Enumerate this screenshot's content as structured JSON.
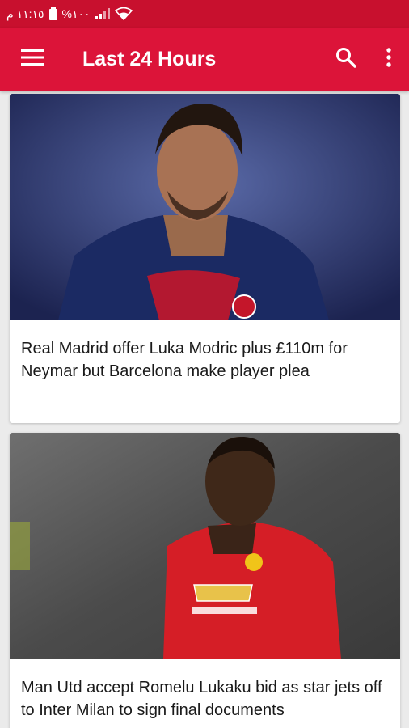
{
  "status_bar": {
    "time": "١١:١٥ م",
    "battery": "%١٠٠"
  },
  "app_bar": {
    "title": "Last 24 Hours",
    "menu_icon": "hamburger-menu-icon",
    "search_icon": "search-icon",
    "overflow_icon": "more-vert-icon"
  },
  "articles": [
    {
      "headline": "Real Madrid offer Luka Modric plus £110m for Neymar but Barcelona make player plea",
      "image": "neymar-psg-photo"
    },
    {
      "headline": "Man Utd accept Romelu Lukaku bid as star jets off to Inter Milan to sign final documents",
      "image": "lukaku-man-utd-photo"
    }
  ],
  "colors": {
    "status_bar": "#c8102e",
    "app_bar": "#dc1439",
    "background": "#ebebeb"
  }
}
